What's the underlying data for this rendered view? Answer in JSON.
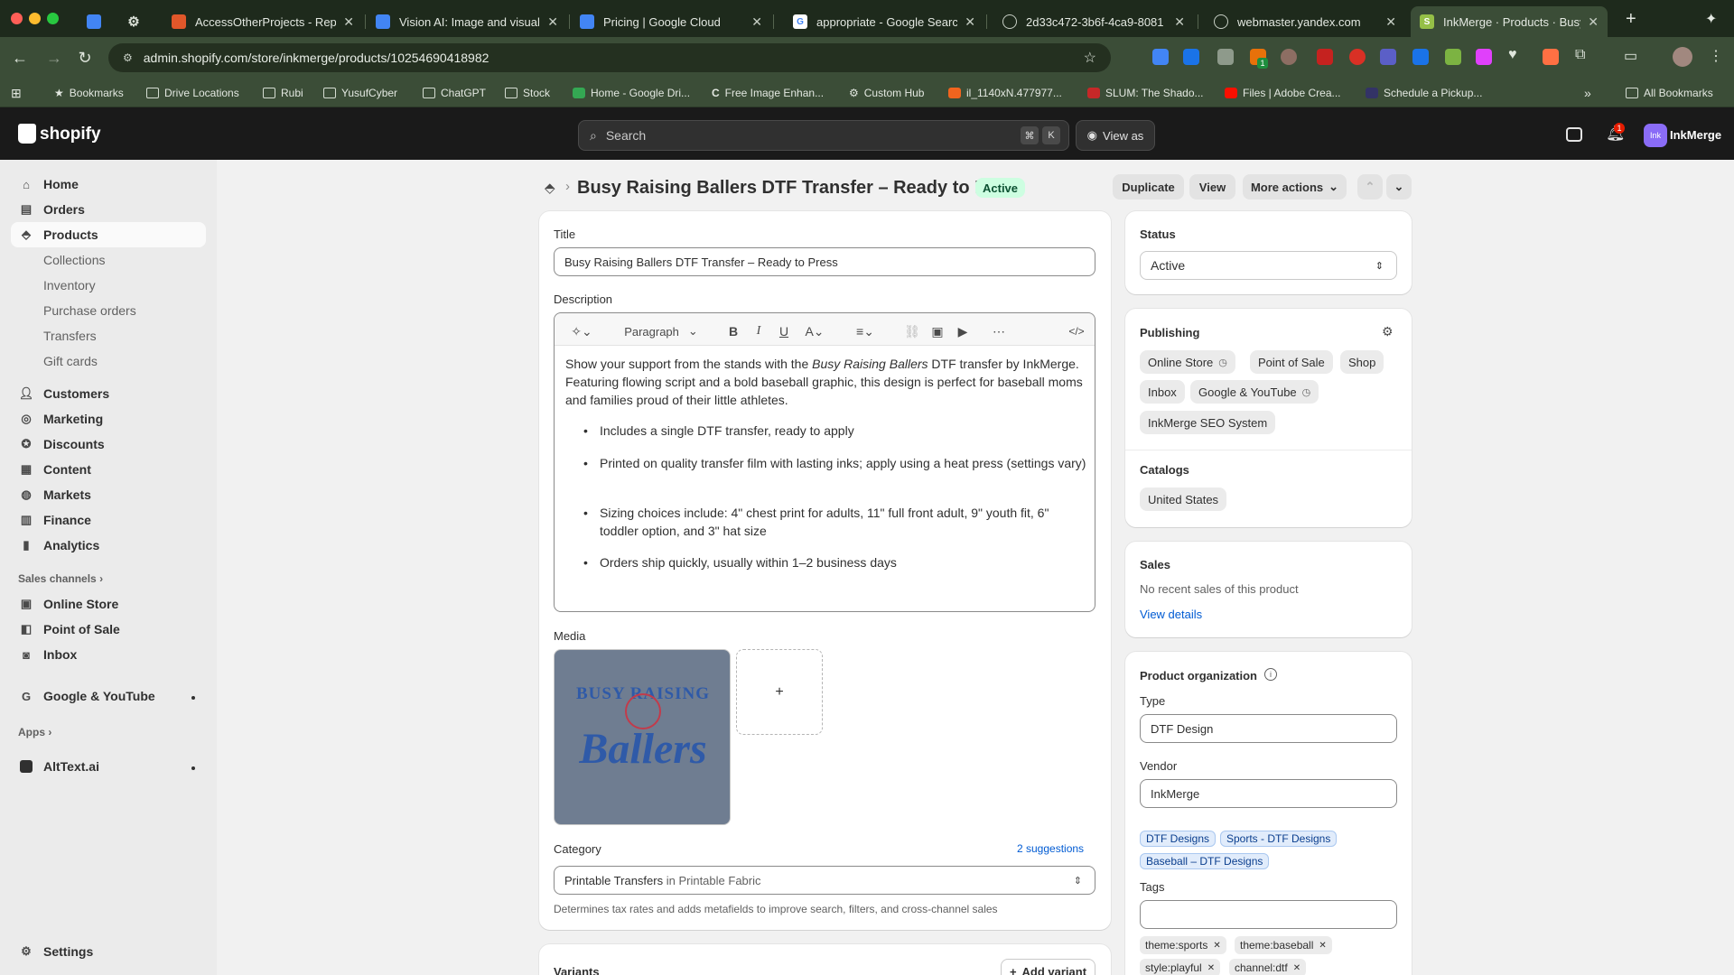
{
  "browser": {
    "tabs": [
      {
        "title": "AccessOtherProjects - Repl",
        "color": "#e0572a"
      },
      {
        "title": "Vision AI: Image and visual A",
        "color": "#4285f4"
      },
      {
        "title": "Pricing  |  Google Cloud",
        "color": "#4285f4"
      },
      {
        "title": "appropriate - Google Search",
        "color": "#ffffff"
      },
      {
        "title": "2d33c472-3b6f-4ca9-8081",
        "color": "#9aa09a"
      },
      {
        "title": "webmaster.yandex.com",
        "color": "#9aa09a"
      },
      {
        "title": "InkMerge · Products · Busy R",
        "color": "#95bf47"
      }
    ],
    "url": "admin.shopify.com/store/inkmerge/products/10254690418982",
    "bookmarks": [
      "Bookmarks",
      "Drive Locations",
      "Rubi",
      "YusufCyber",
      "ChatGPT",
      "Stock",
      "Home - Google Dri...",
      "Free Image Enhan...",
      "Custom Hub",
      "il_1140xN.477977...",
      "SLUM: The Shado...",
      "Files | Adobe Crea...",
      "Schedule a Pickup..."
    ],
    "all_bookmarks": "All Bookmarks",
    "ext_badge": "1"
  },
  "shopify": {
    "logo": "shopify",
    "search_placeholder": "Search",
    "kbd1": "⌘",
    "kbd2": "K",
    "view_as": "View as",
    "notif_count": "1",
    "store_name": "InkMerge",
    "store_avatar": "Ink"
  },
  "sidebar": {
    "home": "Home",
    "orders": "Orders",
    "products": "Products",
    "collections": "Collections",
    "inventory": "Inventory",
    "purchase_orders": "Purchase orders",
    "transfers": "Transfers",
    "gift_cards": "Gift cards",
    "customers": "Customers",
    "marketing": "Marketing",
    "discounts": "Discounts",
    "content": "Content",
    "markets": "Markets",
    "finance": "Finance",
    "analytics": "Analytics",
    "sales_channels": "Sales channels",
    "online_store": "Online Store",
    "point_of_sale": "Point of Sale",
    "inbox": "Inbox",
    "google_youtube": "Google & YouTube",
    "apps": "Apps",
    "alttext": "AltText.ai",
    "settings": "Settings"
  },
  "page": {
    "title": "Busy Raising Ballers DTF Transfer – Ready to Press",
    "status_badge": "Active",
    "duplicate": "Duplicate",
    "view": "View",
    "more_actions": "More actions"
  },
  "product": {
    "title_label": "Title",
    "title_value": "Busy Raising Ballers DTF Transfer – Ready to Press",
    "description_label": "Description",
    "paragraph_select": "Paragraph",
    "desc_intro_1": "Show your support from the stands with the ",
    "desc_intro_em": "Busy Raising Ballers",
    "desc_intro_2": " DTF transfer by InkMerge. Featuring flowing script and a bold baseball graphic, this design is perfect for baseball moms and families proud of their little athletes.",
    "bullets": [
      "Includes a single DTF transfer, ready to apply",
      "Printed on quality transfer film with lasting inks; apply using a heat press (settings vary)",
      "Sizing choices include: 4\" chest print for adults, 11\" full front adult, 9\" youth fit, 6\" toddler option, and 3\" hat size",
      "Orders ship quickly, usually within 1–2 business days"
    ],
    "media_label": "Media",
    "media_text_top": "BUSY RAISING",
    "media_text_main": "Ballers",
    "add_media": "+",
    "category_label": "Category",
    "suggestions": "2 suggestions",
    "category_value": "Printable Transfers",
    "category_in": " in ",
    "category_parent": "Printable Fabric",
    "category_help": "Determines tax rates and adds metafields to improve search, filters, and cross-channel sales",
    "variants_label": "Variants",
    "add_variant": "Add variant"
  },
  "right": {
    "status_label": "Status",
    "status_value": "Active",
    "publishing_label": "Publishing",
    "channels": [
      "Online Store",
      "Point of Sale",
      "Shop",
      "Inbox",
      "Google & YouTube",
      "InkMerge SEO System"
    ],
    "catalogs_label": "Catalogs",
    "catalog": "United States",
    "sales_label": "Sales",
    "sales_text": "No recent sales of this product",
    "view_details": "View details",
    "org_label": "Product organization",
    "type_label": "Type",
    "type_value": "DTF Design",
    "vendor_label": "Vendor",
    "vendor_value": "InkMerge",
    "collections": [
      "DTF Designs",
      "Sports - DTF Designs",
      "Baseball – DTF Designs"
    ],
    "tags_label": "Tags",
    "tags": [
      "theme:sports",
      "theme:baseball",
      "style:playful",
      "channel:dtf"
    ]
  },
  "colors": {
    "shopify_green": "#95bf47",
    "active_badge_bg": "#cdfee1",
    "active_badge_fg": "#0c5132",
    "link_blue": "#005bd3",
    "media_bg": "#6f7d91"
  }
}
